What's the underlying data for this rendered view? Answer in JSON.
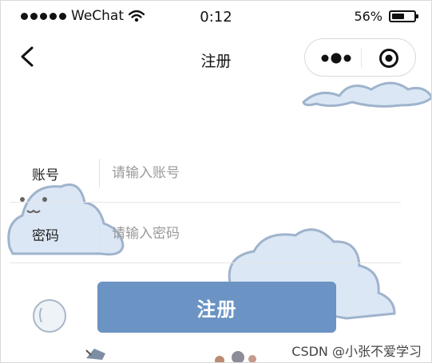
{
  "status_bar": {
    "carrier": "WeChat",
    "time": "0:12",
    "battery_text": "56%",
    "battery_level": 0.56
  },
  "nav": {
    "title": "注册"
  },
  "form": {
    "account_label": "账号",
    "account_placeholder": "请输入账号",
    "password_label": "密码",
    "password_placeholder": "请输入密码"
  },
  "register_button": "注册",
  "watermark": "CSDN @小张不爱学习",
  "icons": {
    "back": "chevron-left-icon",
    "more": "more-dots-icon",
    "close": "target-circle-icon",
    "wifi": "wifi-icon",
    "battery": "battery-icon"
  },
  "colors": {
    "button": "#6b93c4",
    "cloud_fill": "#dbe7f5",
    "cloud_stroke": "#9fb3cc"
  }
}
